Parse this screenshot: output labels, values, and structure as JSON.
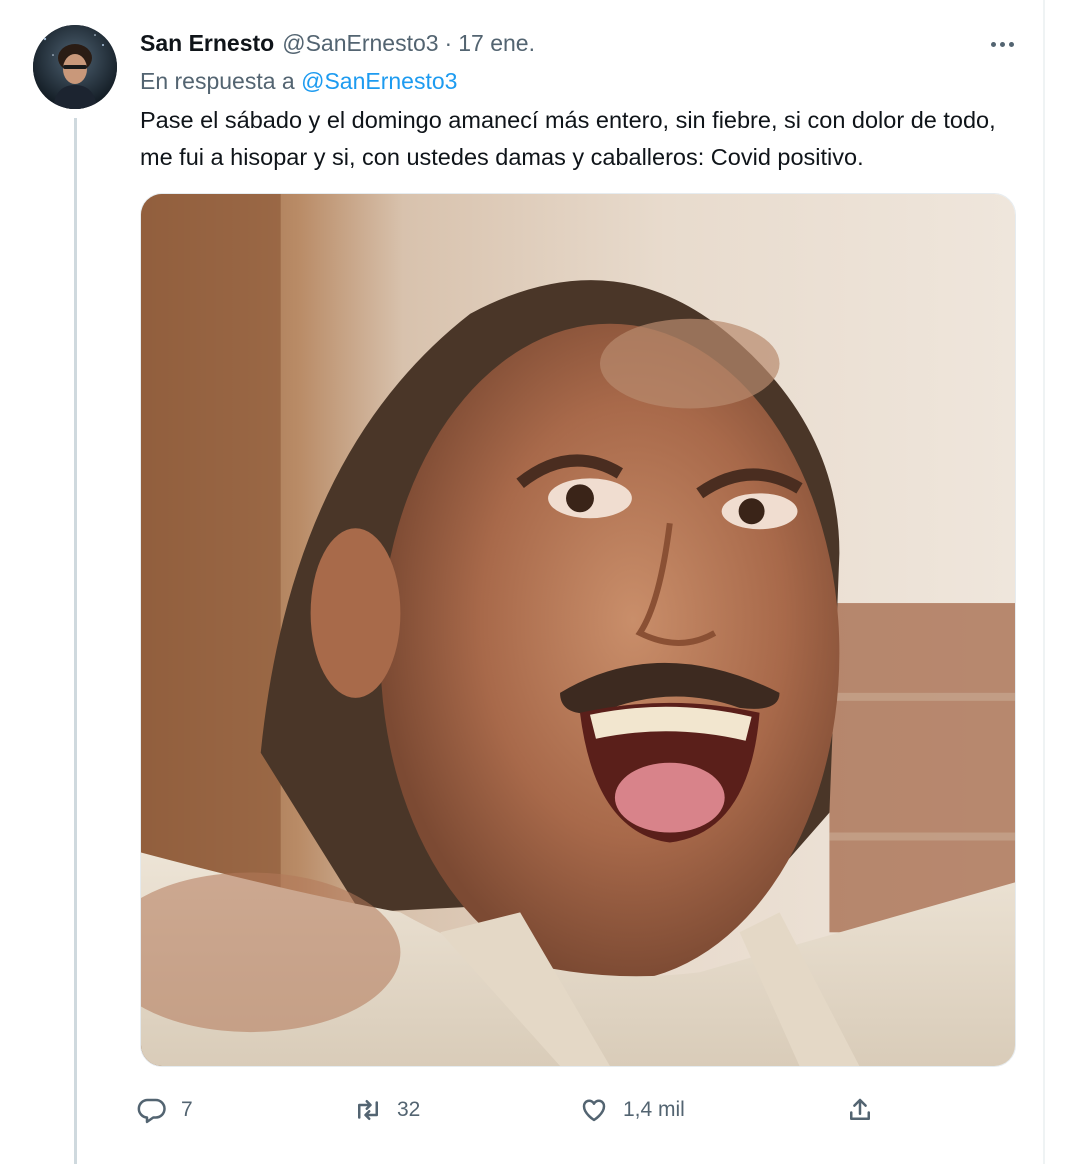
{
  "tweet": {
    "author_name": "San Ernesto",
    "author_handle": "@SanErnesto3",
    "separator": "·",
    "date": "17 ene.",
    "reply_prefix": "En respuesta a",
    "reply_handle": "@SanErnesto3",
    "text": "Pase el sábado y el domingo amanecí más entero, sin fiebre, si con dolor de todo, me fui a hisopar y si, con ustedes damas y caballeros: Covid positivo.",
    "media_description_icon": "photo"
  },
  "actions": {
    "reply_count": "7",
    "retweet_count": "32",
    "like_count": "1,4 mil"
  },
  "icons": {
    "reply": "reply-icon",
    "retweet": "retweet-icon",
    "like": "heart-icon",
    "share": "share-icon",
    "more": "more-options-icon"
  },
  "colors": {
    "text": "#0f1419",
    "secondary": "#536471",
    "link": "#1d9bf0",
    "thread_line": "#cfd9de"
  }
}
